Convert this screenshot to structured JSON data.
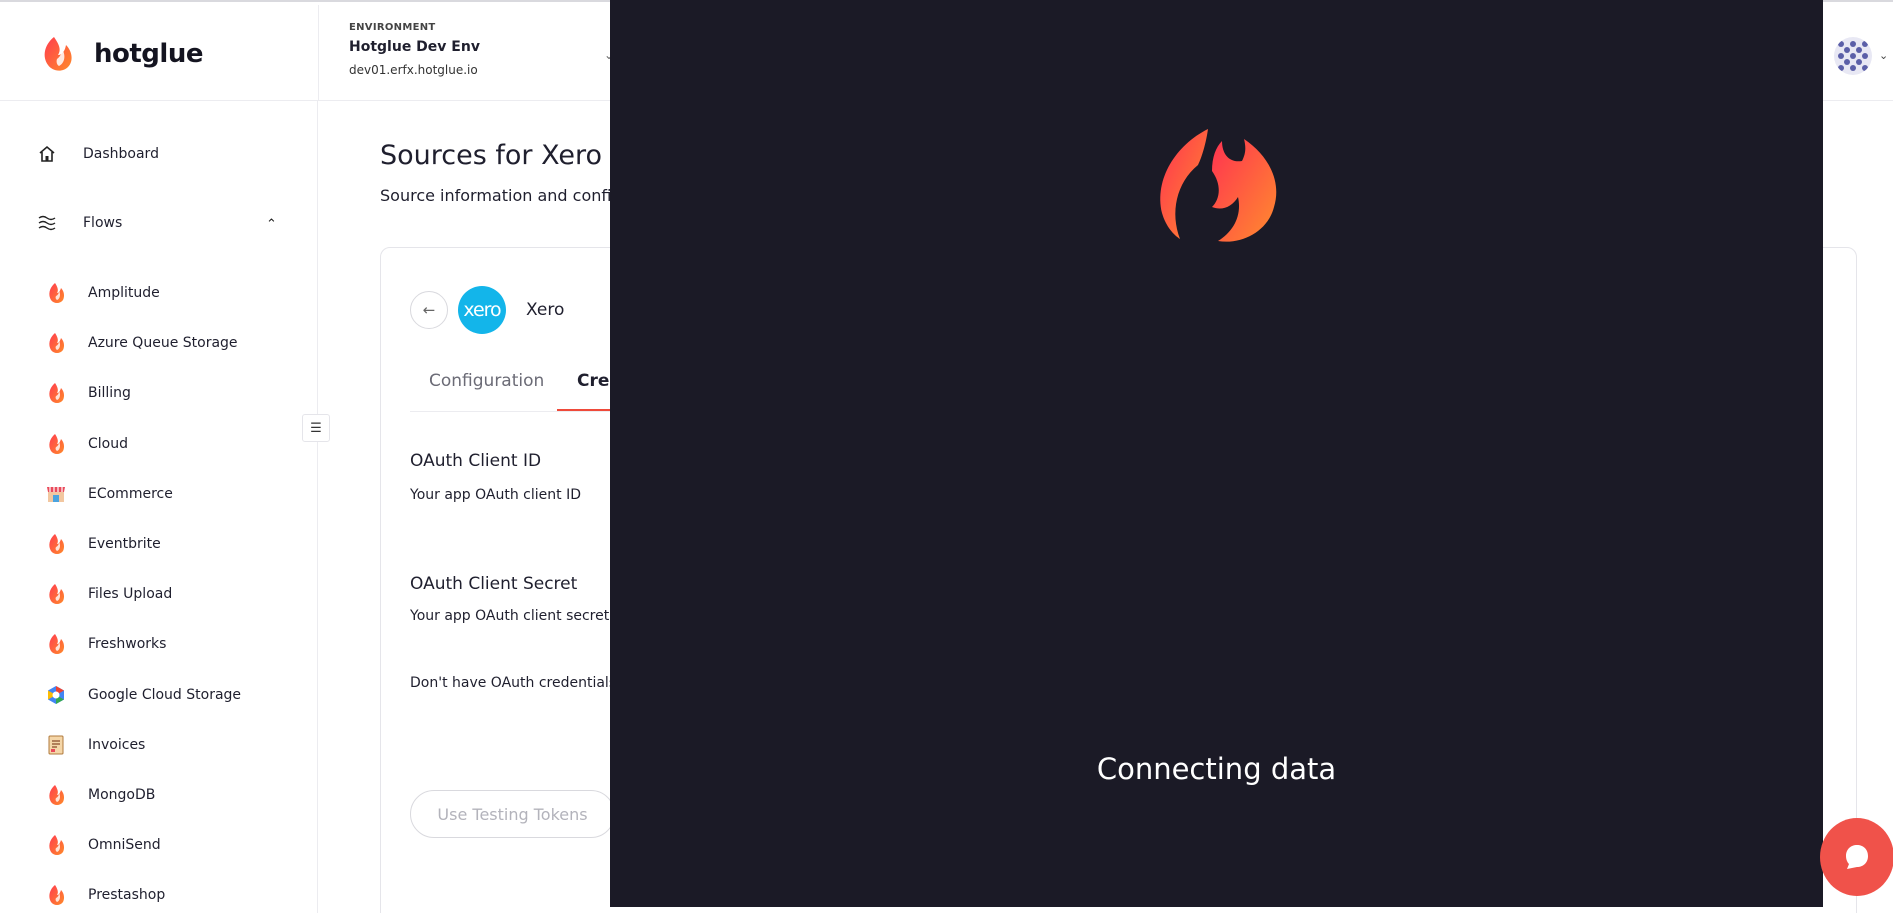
{
  "app": {
    "brand": "hotglue"
  },
  "environment": {
    "label": "ENVIRONMENT",
    "name": "Hotglue Dev Env",
    "url": "dev01.erfx.hotglue.io"
  },
  "sidebar": {
    "dashboard_label": "Dashboard",
    "flows_label": "Flows",
    "flows": [
      {
        "label": "Amplitude",
        "icon": "flame-icon"
      },
      {
        "label": "Azure Queue Storage",
        "icon": "flame-icon"
      },
      {
        "label": "Billing",
        "icon": "flame-icon"
      },
      {
        "label": "Cloud",
        "icon": "flame-icon"
      },
      {
        "label": "ECommerce",
        "icon": "storefront-icon"
      },
      {
        "label": "Eventbrite",
        "icon": "flame-icon"
      },
      {
        "label": "Files Upload",
        "icon": "flame-icon"
      },
      {
        "label": "Freshworks",
        "icon": "flame-icon"
      },
      {
        "label": "Google Cloud Storage",
        "icon": "gcs-icon"
      },
      {
        "label": "Invoices",
        "icon": "invoice-icon"
      },
      {
        "label": "MongoDB",
        "icon": "flame-icon"
      },
      {
        "label": "OmniSend",
        "icon": "flame-icon"
      },
      {
        "label": "Prestashop",
        "icon": "flame-icon"
      }
    ]
  },
  "main": {
    "title": "Sources for Xero",
    "subtitle": "Source information and configu",
    "source": {
      "logo_text": "xero",
      "name": "Xero"
    },
    "tabs": {
      "configuration": "Configuration",
      "credentials": "Cred"
    },
    "fields": {
      "client_id_label": "OAuth Client ID",
      "client_id_help": "Your app OAuth client ID",
      "client_secret_label": "OAuth Client Secret",
      "client_secret_help": "Your app OAuth client secret",
      "no_credentials": "Don't have OAuth credentials? P"
    },
    "testing_button": "Use Testing Tokens"
  },
  "overlay": {
    "message": "Connecting data"
  },
  "colors": {
    "brand_red": "#ef4a3a",
    "overlay_bg": "#1b1a26",
    "xero_blue": "#13b5ea"
  }
}
